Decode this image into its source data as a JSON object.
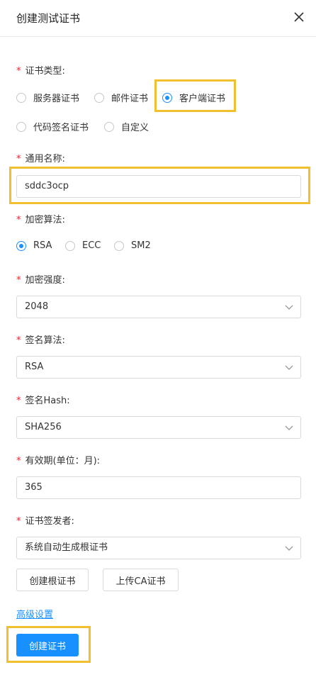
{
  "dialog": {
    "title": "创建测试证书"
  },
  "form": {
    "cert_type": {
      "label": "证书类型",
      "options": [
        "服务器证书",
        "邮件证书",
        "客户端证书",
        "代码签名证书",
        "自定义"
      ],
      "selected": "客户端证书"
    },
    "common_name": {
      "label": "通用名称",
      "value": "sddc3ocp"
    },
    "encryption_algorithm": {
      "label": "加密算法",
      "options": [
        "RSA",
        "ECC",
        "SM2"
      ],
      "selected": "RSA"
    },
    "encryption_strength": {
      "label": "加密强度",
      "value": "2048"
    },
    "signature_algorithm": {
      "label": "签名算法",
      "value": "RSA"
    },
    "signature_hash": {
      "label": "签名Hash",
      "value": "SHA256"
    },
    "validity": {
      "label": "有效期(单位：月)",
      "value": "365"
    },
    "issuer": {
      "label": "证书签发者",
      "value": "系统自动生成根证书"
    },
    "buttons": {
      "create_root": "创建根证书",
      "upload_ca": "上传CA证书"
    },
    "advanced_link": "高级设置",
    "submit": "创建证书"
  },
  "colors": {
    "primary": "#1890ff",
    "required": "#f5222d",
    "highlight": "#f0c030"
  }
}
